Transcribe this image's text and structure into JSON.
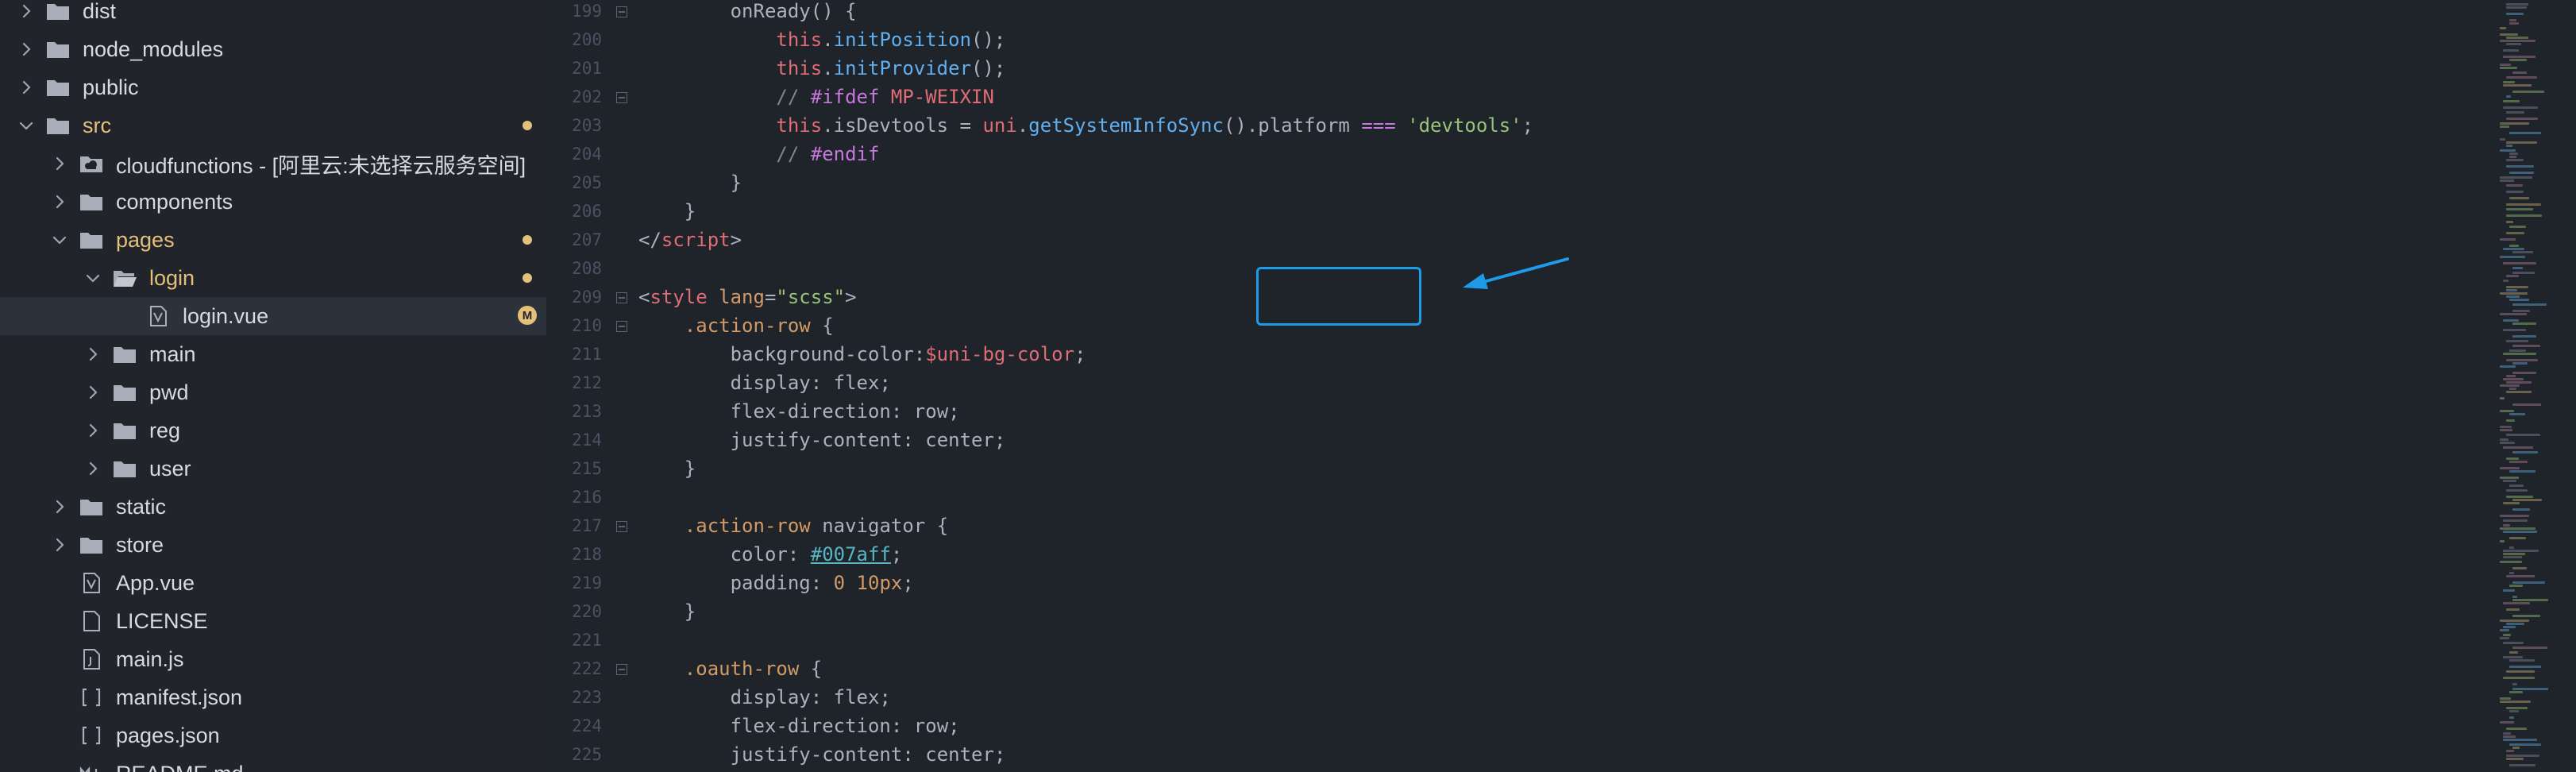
{
  "colors": {
    "sidebar_bg": "#21252b",
    "editor_bg": "#1f232a",
    "modified": "#e5c07b",
    "highlight": "#1e9be8"
  },
  "explorer": {
    "items": [
      {
        "label": "dist",
        "depth": 0,
        "type": "folder",
        "expanded": false,
        "modified": false
      },
      {
        "label": "node_modules",
        "depth": 0,
        "type": "folder",
        "expanded": false,
        "modified": false
      },
      {
        "label": "public",
        "depth": 0,
        "type": "folder",
        "expanded": false,
        "modified": false
      },
      {
        "label": "src",
        "depth": 0,
        "type": "folder",
        "expanded": true,
        "modified": true
      },
      {
        "label": "cloudfunctions - [阿里云:未选择云服务空间]",
        "depth": 1,
        "type": "cloud-folder",
        "expanded": false,
        "modified": false
      },
      {
        "label": "components",
        "depth": 1,
        "type": "folder",
        "expanded": false,
        "modified": false
      },
      {
        "label": "pages",
        "depth": 1,
        "type": "folder",
        "expanded": true,
        "modified": true
      },
      {
        "label": "login",
        "depth": 2,
        "type": "folder-open",
        "expanded": true,
        "modified": true
      },
      {
        "label": "login.vue",
        "depth": 3,
        "type": "vue-file",
        "selected": true,
        "badge": "M"
      },
      {
        "label": "main",
        "depth": 2,
        "type": "folder",
        "expanded": false,
        "modified": false
      },
      {
        "label": "pwd",
        "depth": 2,
        "type": "folder",
        "expanded": false,
        "modified": false
      },
      {
        "label": "reg",
        "depth": 2,
        "type": "folder",
        "expanded": false,
        "modified": false
      },
      {
        "label": "user",
        "depth": 2,
        "type": "folder",
        "expanded": false,
        "modified": false
      },
      {
        "label": "static",
        "depth": 1,
        "type": "folder",
        "expanded": false,
        "modified": false
      },
      {
        "label": "store",
        "depth": 1,
        "type": "folder",
        "expanded": false,
        "modified": false
      },
      {
        "label": "App.vue",
        "depth": 1,
        "type": "vue-file"
      },
      {
        "label": "LICENSE",
        "depth": 1,
        "type": "text-file"
      },
      {
        "label": "main.js",
        "depth": 1,
        "type": "js-file"
      },
      {
        "label": "manifest.json",
        "depth": 1,
        "type": "json-file"
      },
      {
        "label": "pages.json",
        "depth": 1,
        "type": "json-file"
      },
      {
        "label": "README.md",
        "depth": 1,
        "type": "md-file"
      }
    ]
  },
  "editor": {
    "lines": [
      {
        "num": "199",
        "fold": true,
        "tokens": [
          [
            "plain",
            "        onReady() {"
          ]
        ]
      },
      {
        "num": "200",
        "fold": false,
        "tokens": [
          [
            "plain",
            "            "
          ],
          [
            "this",
            "this"
          ],
          [
            "plain",
            "."
          ],
          [
            "fn",
            "initPosition"
          ],
          [
            "plain",
            "();"
          ]
        ]
      },
      {
        "num": "201",
        "fold": false,
        "tokens": [
          [
            "plain",
            "            "
          ],
          [
            "this",
            "this"
          ],
          [
            "plain",
            "."
          ],
          [
            "fn",
            "initProvider"
          ],
          [
            "plain",
            "();"
          ]
        ]
      },
      {
        "num": "202",
        "fold": true,
        "tokens": [
          [
            "plain",
            "            "
          ],
          [
            "comment",
            "// "
          ],
          [
            "directive",
            "#ifdef"
          ],
          [
            "plain",
            " "
          ],
          [
            "macro",
            "MP-WEIXIN"
          ]
        ]
      },
      {
        "num": "203",
        "fold": false,
        "tokens": [
          [
            "plain",
            "            "
          ],
          [
            "this",
            "this"
          ],
          [
            "plain",
            ".isDevtools = "
          ],
          [
            "obj",
            "uni"
          ],
          [
            "plain",
            "."
          ],
          [
            "fn",
            "getSystemInfoSync"
          ],
          [
            "plain",
            "().platform "
          ],
          [
            "op",
            "==="
          ],
          [
            "plain",
            " "
          ],
          [
            "str",
            "'devtools'"
          ],
          [
            "plain",
            ";"
          ]
        ]
      },
      {
        "num": "204",
        "fold": false,
        "tokens": [
          [
            "plain",
            "            "
          ],
          [
            "comment",
            "// "
          ],
          [
            "directive",
            "#endif"
          ]
        ]
      },
      {
        "num": "205",
        "fold": false,
        "tokens": [
          [
            "plain",
            "        }"
          ]
        ]
      },
      {
        "num": "206",
        "fold": false,
        "tokens": [
          [
            "plain",
            "    }"
          ]
        ]
      },
      {
        "num": "207",
        "fold": false,
        "tokens": [
          [
            "plain",
            "</"
          ],
          [
            "tag",
            "script"
          ],
          [
            "plain",
            ">"
          ]
        ]
      },
      {
        "num": "208",
        "fold": false,
        "tokens": []
      },
      {
        "num": "209",
        "fold": true,
        "tokens": [
          [
            "plain",
            "<"
          ],
          [
            "tag",
            "style"
          ],
          [
            "plain",
            " "
          ],
          [
            "attr",
            "lang"
          ],
          [
            "plain",
            "="
          ],
          [
            "str",
            "\"scss\""
          ],
          [
            "plain",
            ">"
          ]
        ]
      },
      {
        "num": "210",
        "fold": true,
        "tokens": [
          [
            "plain",
            "    "
          ],
          [
            "sel",
            ".action-row"
          ],
          [
            "plain",
            " {"
          ]
        ]
      },
      {
        "num": "211",
        "fold": false,
        "tokens": [
          [
            "plain",
            "        "
          ],
          [
            "prop",
            "background-color"
          ],
          [
            "plain",
            ":"
          ],
          [
            "var",
            "$uni-bg-color"
          ],
          [
            "plain",
            ";"
          ]
        ]
      },
      {
        "num": "212",
        "fold": false,
        "tokens": [
          [
            "plain",
            "        "
          ],
          [
            "prop",
            "display"
          ],
          [
            "plain",
            ": flex;"
          ]
        ]
      },
      {
        "num": "213",
        "fold": false,
        "tokens": [
          [
            "plain",
            "        "
          ],
          [
            "prop",
            "flex-direction"
          ],
          [
            "plain",
            ": row;"
          ]
        ]
      },
      {
        "num": "214",
        "fold": false,
        "tokens": [
          [
            "plain",
            "        "
          ],
          [
            "prop",
            "justify-content"
          ],
          [
            "plain",
            ": center;"
          ]
        ]
      },
      {
        "num": "215",
        "fold": false,
        "tokens": [
          [
            "plain",
            "    }"
          ]
        ]
      },
      {
        "num": "216",
        "fold": false,
        "tokens": []
      },
      {
        "num": "217",
        "fold": true,
        "tokens": [
          [
            "plain",
            "    "
          ],
          [
            "sel",
            ".action-row"
          ],
          [
            "plain",
            " navigator {"
          ]
        ]
      },
      {
        "num": "218",
        "fold": false,
        "tokens": [
          [
            "plain",
            "        "
          ],
          [
            "prop",
            "color"
          ],
          [
            "plain",
            ": "
          ],
          [
            "hex",
            "#007aff"
          ],
          [
            "plain",
            ";"
          ]
        ]
      },
      {
        "num": "219",
        "fold": false,
        "tokens": [
          [
            "plain",
            "        "
          ],
          [
            "prop",
            "padding"
          ],
          [
            "plain",
            ": "
          ],
          [
            "num",
            "0 10px"
          ],
          [
            "plain",
            ";"
          ]
        ]
      },
      {
        "num": "220",
        "fold": false,
        "tokens": [
          [
            "plain",
            "    }"
          ]
        ]
      },
      {
        "num": "221",
        "fold": false,
        "tokens": []
      },
      {
        "num": "222",
        "fold": true,
        "tokens": [
          [
            "plain",
            "    "
          ],
          [
            "sel",
            ".oauth-row"
          ],
          [
            "plain",
            " {"
          ]
        ]
      },
      {
        "num": "223",
        "fold": false,
        "tokens": [
          [
            "plain",
            "        "
          ],
          [
            "prop",
            "display"
          ],
          [
            "plain",
            ": flex;"
          ]
        ]
      },
      {
        "num": "224",
        "fold": false,
        "tokens": [
          [
            "plain",
            "        "
          ],
          [
            "prop",
            "flex-direction"
          ],
          [
            "plain",
            ": row;"
          ]
        ]
      },
      {
        "num": "225",
        "fold": false,
        "tokens": [
          [
            "plain",
            "        "
          ],
          [
            "prop",
            "justify-content"
          ],
          [
            "plain",
            ": center;"
          ]
        ]
      }
    ]
  }
}
